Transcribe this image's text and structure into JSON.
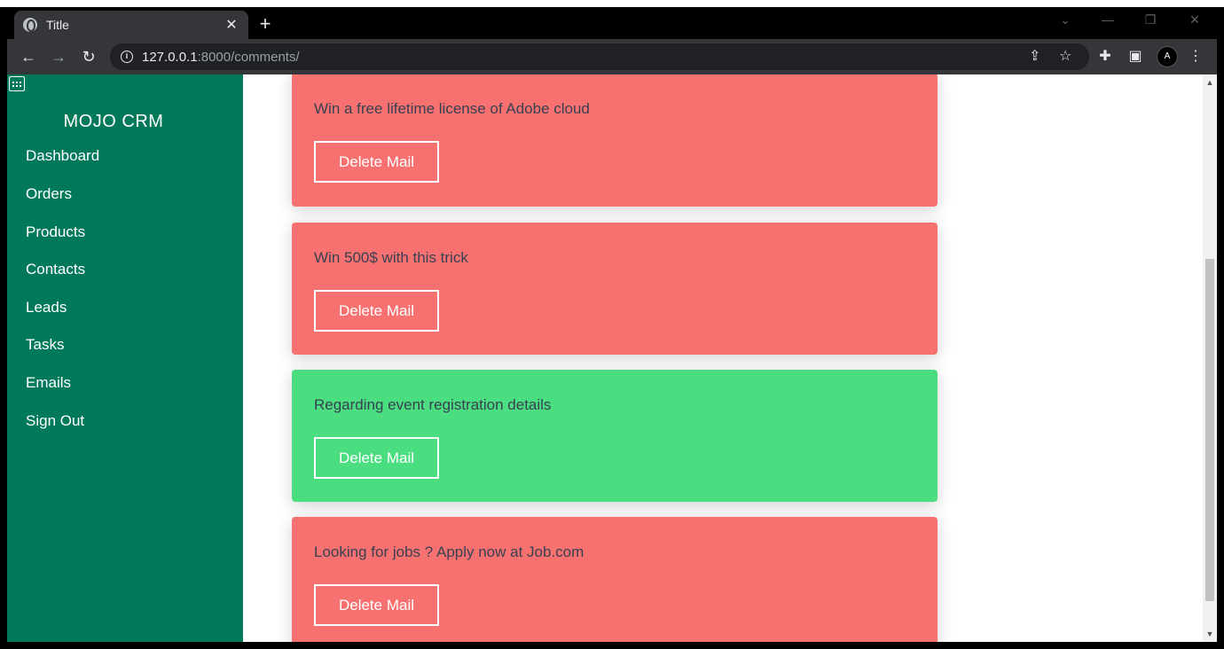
{
  "browser": {
    "tab_title": "Title",
    "tab_close": "✕",
    "new_tab": "+",
    "url_host": "127.0.0.1",
    "url_path": ":8000/comments/"
  },
  "app": {
    "brand": "MOJO CRM",
    "nav": [
      "Dashboard",
      "Orders",
      "Products",
      "Contacts",
      "Leads",
      "Tasks",
      "Emails",
      "Sign Out"
    ]
  },
  "mails": [
    {
      "text": "Win a free lifetime license of Adobe cloud",
      "status": "spam",
      "color": "#f87171",
      "button": "Delete Mail"
    },
    {
      "text": "Win 500$ with this trick",
      "status": "spam",
      "color": "#f87171",
      "button": "Delete Mail"
    },
    {
      "text": "Regarding event registration details",
      "status": "ok",
      "color": "#4ade80",
      "button": "Delete Mail"
    },
    {
      "text": "Looking for jobs ? Apply now at Job.com",
      "status": "spam",
      "color": "#f87171",
      "button": "Delete Mail"
    }
  ],
  "colors": {
    "sidebar": "#00785a",
    "spam": "#f87171",
    "ok": "#4ade80"
  }
}
